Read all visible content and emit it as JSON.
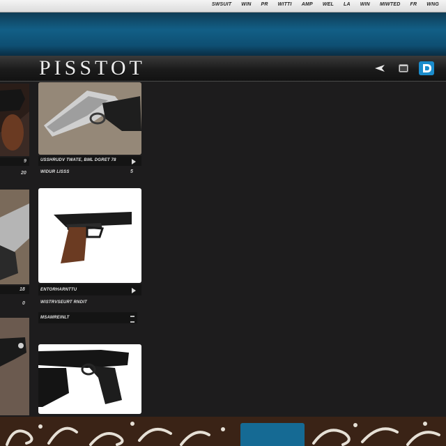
{
  "top_nav": {
    "items": [
      "SWSUIT",
      "WIN",
      "PR",
      "WITTI",
      "AMP",
      "WEL",
      "LA",
      "WIN",
      "MIWTED",
      "FR",
      "WNG"
    ]
  },
  "header": {
    "logo_text": "PISSTOT",
    "icons": [
      "back-arrow-icon",
      "window-icon",
      "brand-logo-icon"
    ]
  },
  "colors": {
    "banner_blue": "#125f86",
    "header_dark": "#1b1b1b",
    "footer_brown": "#3a2316",
    "footer_tab_blue": "#156a94"
  },
  "left_column": {
    "items": [
      {
        "number_a": "9",
        "number_b": "20"
      },
      {
        "number_a": "18",
        "number_b": "0"
      }
    ]
  },
  "cards": [
    {
      "caption": "USSHRUDV TWATE, BML DGRET 78",
      "subcaption": "WIDUR LISSS",
      "meta": "5",
      "image": "silver-pistol-on-fabric"
    },
    {
      "caption": "ENTORHARNTTU",
      "subcaption": "WISTRVSEURT RNDIT",
      "extra": "MSAMREINLT",
      "image": "walnut-grip-pistol"
    },
    {
      "caption": "",
      "image": "black-pistol"
    }
  ]
}
